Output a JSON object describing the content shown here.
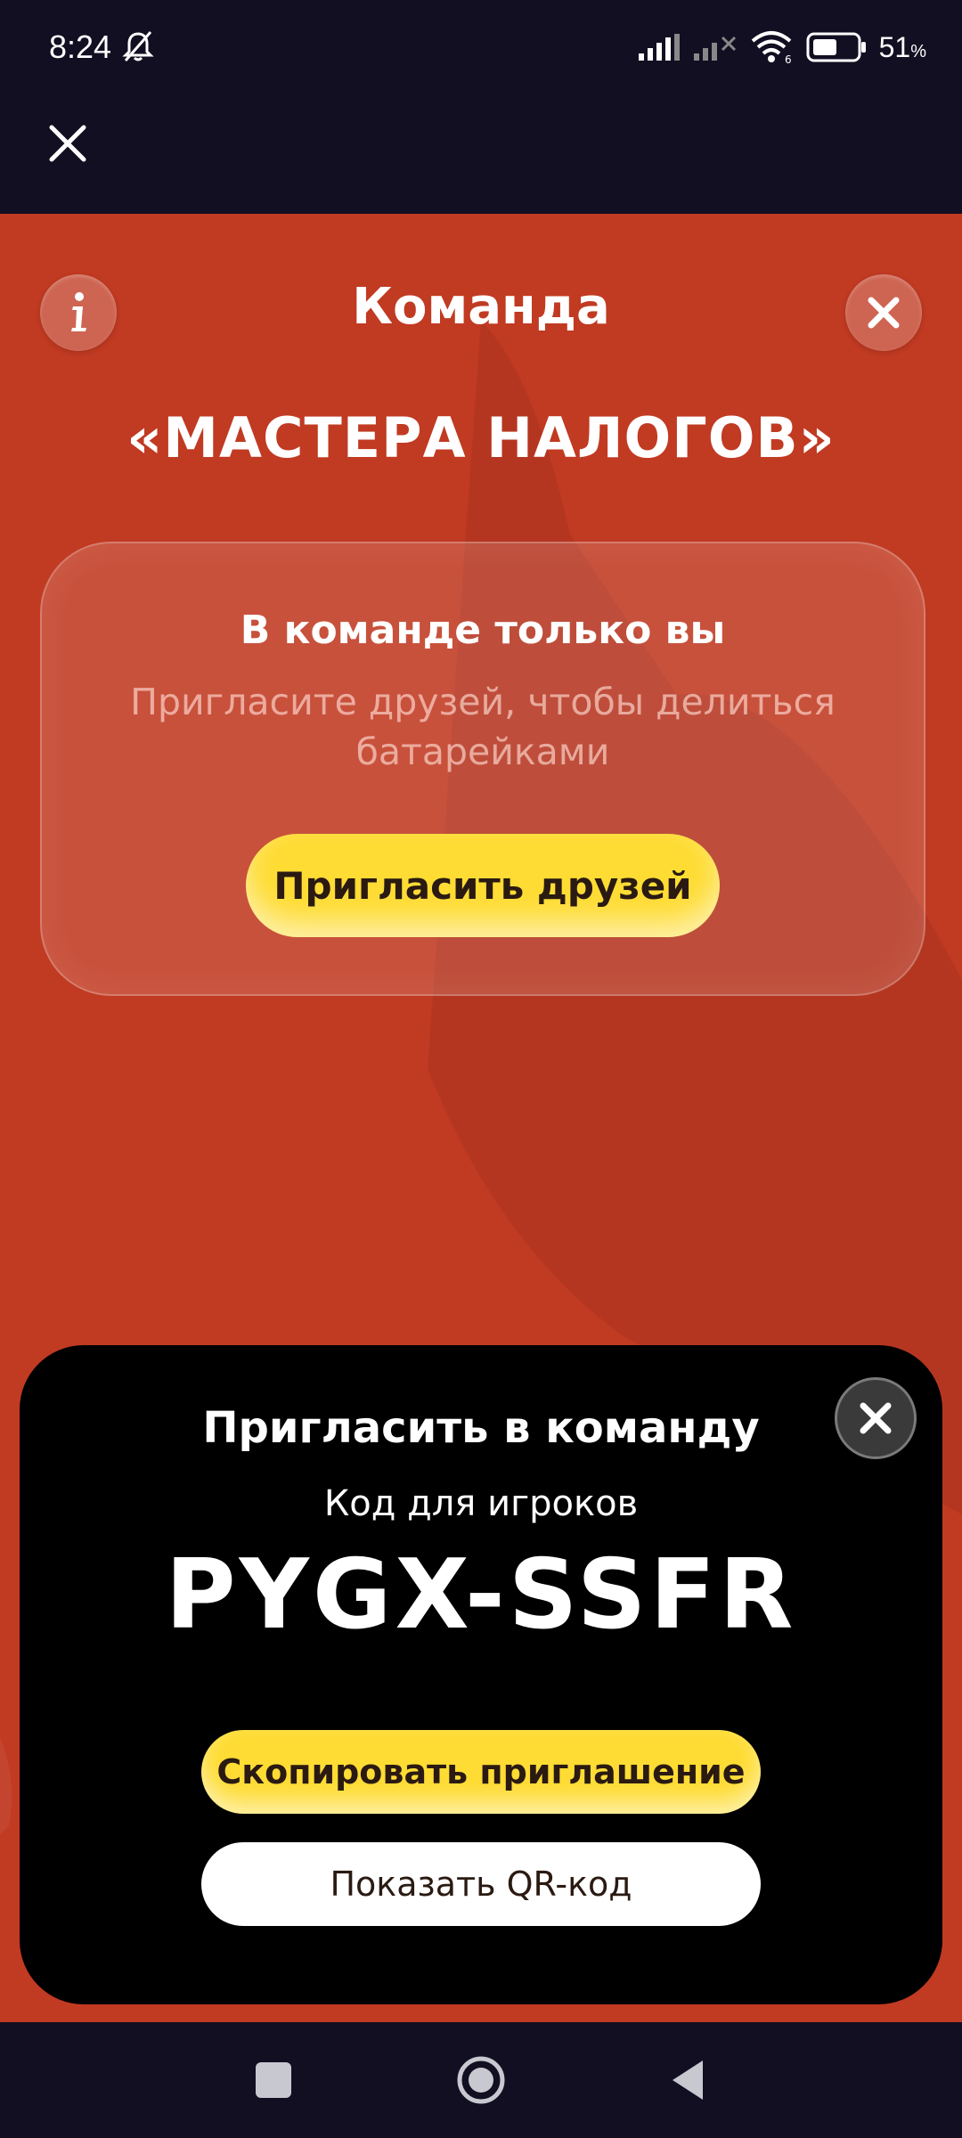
{
  "status_bar": {
    "time": "8:24",
    "battery_percent": "51",
    "battery_unit": "%"
  },
  "header": {
    "title": "Команда",
    "team_name": "«МАСТЕРА НАЛОГОВ»"
  },
  "card": {
    "title": "В команде только вы",
    "text": "Пригласите друзей, чтобы делиться батарейками",
    "invite_button": "Пригласить друзей"
  },
  "sheet": {
    "title": "Пригласить в команду",
    "code_label": "Код для игроков",
    "code": "PYGX-SSFR",
    "copy_button": "Скопировать приглашение",
    "qr_button": "Показать QR-код"
  },
  "colors": {
    "background": "#c13a22",
    "accent_yellow": "#fedc34",
    "bars": "#120f22"
  },
  "icons": [
    "bell-off-icon",
    "signal-icon",
    "no-signal-icon",
    "wifi-icon",
    "battery-icon",
    "close-icon",
    "info-icon",
    "square-nav-icon",
    "home-nav-icon",
    "back-nav-icon"
  ]
}
